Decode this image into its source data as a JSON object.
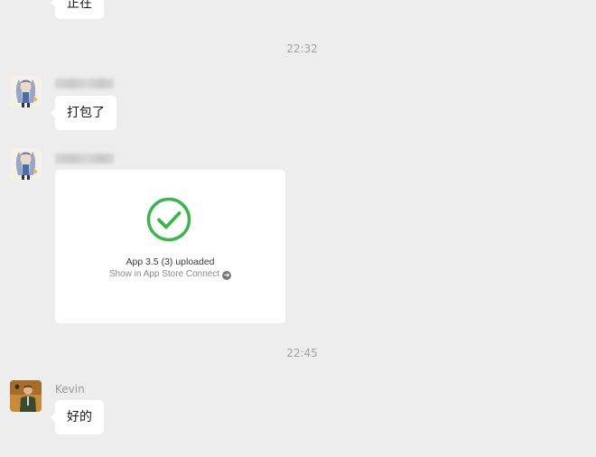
{
  "messages": [
    {
      "text": "正在"
    },
    {
      "time": "22:32"
    },
    {
      "text": "打包了"
    },
    {
      "card": {
        "title": "App 3.5 (3) uploaded",
        "link": "Show in App Store Connect"
      }
    },
    {
      "time": "22:45"
    },
    {
      "sender": "Kevin",
      "text": "好的"
    }
  ],
  "icons": {
    "card_status": "checkmark-circle-icon",
    "card_link": "arrow-right-circle-icon"
  },
  "colors": {
    "background": "#ededed",
    "bubble": "#ffffff",
    "success_green": "#3bb54a"
  }
}
